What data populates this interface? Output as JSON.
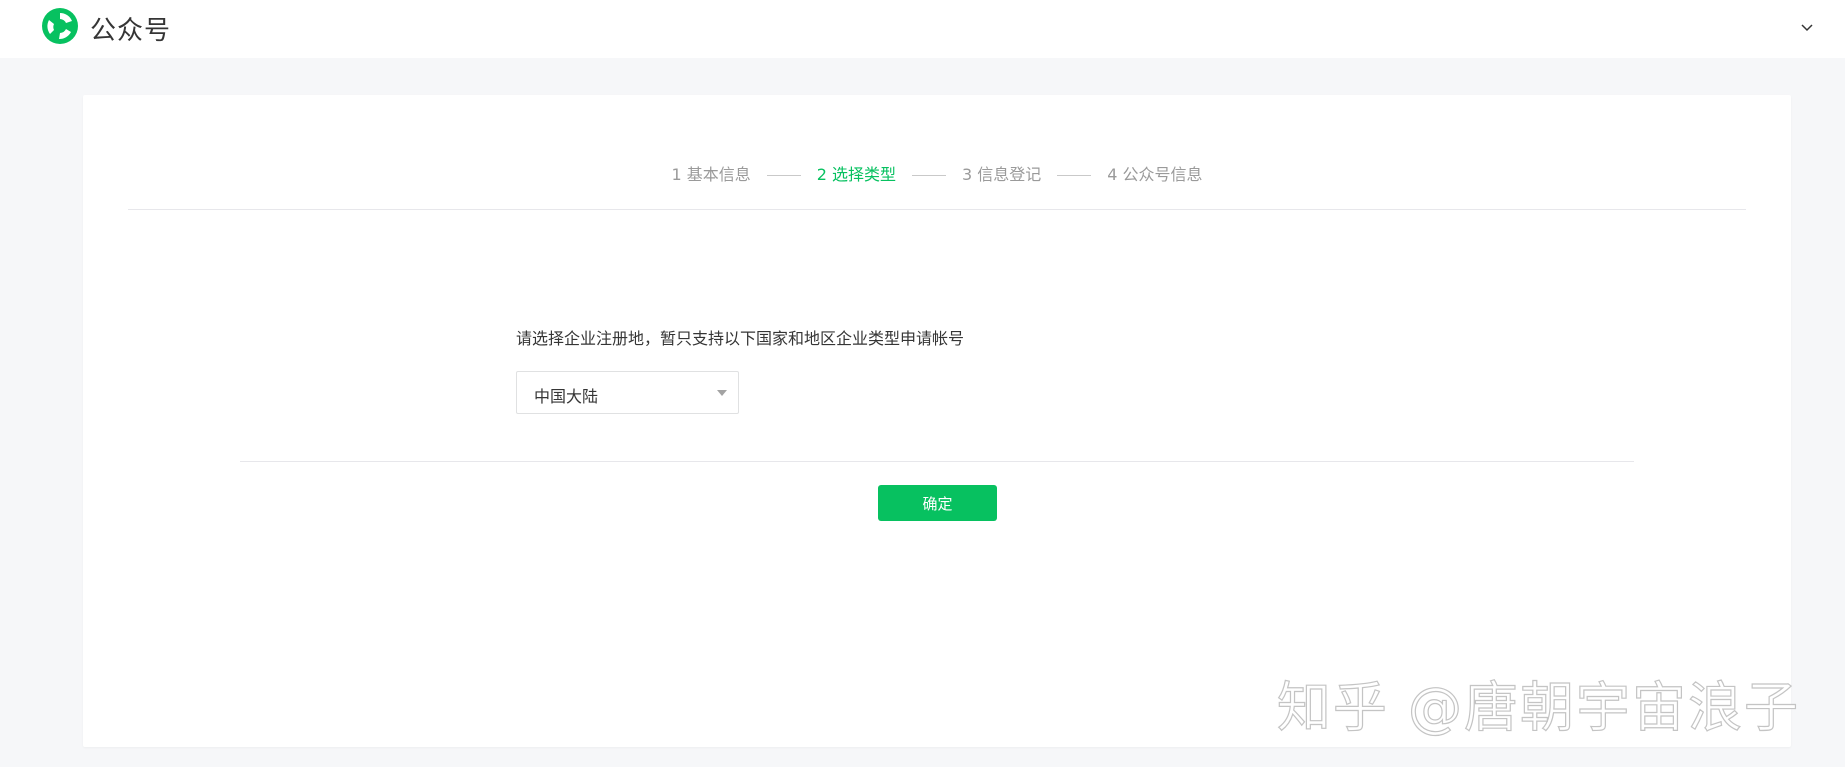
{
  "header": {
    "app_name": "公众号",
    "logo_icon": "wechat-official-account-logo",
    "brand_color": "#07c160",
    "account_toggle_icon": "chevron-down-icon"
  },
  "steps": [
    {
      "label": "1 基本信息",
      "state": "done"
    },
    {
      "label": "2 选择类型",
      "state": "active"
    },
    {
      "label": "3 信息登记",
      "state": "pending"
    },
    {
      "label": "4 公众号信息",
      "state": "pending"
    }
  ],
  "form": {
    "prompt": "请选择企业注册地，暂只支持以下国家和地区企业类型申请帐号",
    "region_select": {
      "value": "中国大陆"
    },
    "confirm_label": "确定"
  },
  "watermark": "知乎 @唐朝宇宙浪子"
}
